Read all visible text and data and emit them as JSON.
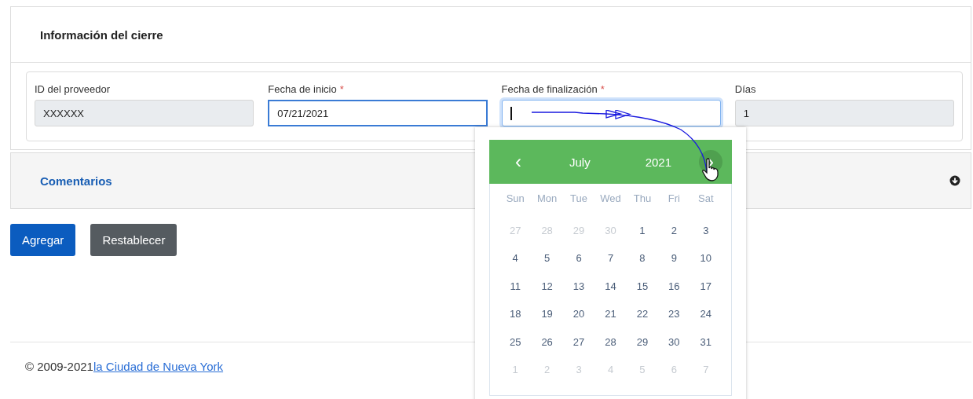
{
  "closure_panel": {
    "title": "Información del cierre",
    "fields": [
      {
        "label": "ID del proveedor",
        "value": "XXXXXX",
        "kind": "readonly"
      },
      {
        "label": "Fecha de inicio",
        "required_mark": "*",
        "value": "07/21/2021",
        "kind": "outlined"
      },
      {
        "label": "Fecha de finalización",
        "required_mark": "*",
        "kind": "focused"
      },
      {
        "label": "Días",
        "value": "1",
        "kind": "readonly"
      }
    ]
  },
  "comments_panel": {
    "title": "Comentarios",
    "expanded": false
  },
  "buttons": [
    {
      "label": "Agregar",
      "kind": "primary"
    },
    {
      "label": "Restablecer",
      "kind": "secondary"
    }
  ],
  "footer": {
    "copyright": "© 2009-2021",
    "link": "la Ciudad de Nueva York"
  },
  "datepicker": {
    "prev": "‹",
    "month": "July",
    "year": "2021",
    "next": "›",
    "next_hovered": true,
    "weekdays": [
      "Sun",
      "Mon",
      "Tue",
      "Wed",
      "Thu",
      "Fri",
      "Sat"
    ],
    "weeks": [
      [
        {
          "day": "27",
          "kind": "other"
        },
        {
          "day": "28",
          "kind": "other"
        },
        {
          "day": "29",
          "kind": "other"
        },
        {
          "day": "30",
          "kind": "other"
        },
        {
          "day": "1",
          "kind": "current"
        },
        {
          "day": "2",
          "kind": "current"
        },
        {
          "day": "3",
          "kind": "current"
        }
      ],
      [
        {
          "day": "4",
          "kind": "current"
        },
        {
          "day": "5",
          "kind": "current"
        },
        {
          "day": "6",
          "kind": "current"
        },
        {
          "day": "7",
          "kind": "current"
        },
        {
          "day": "8",
          "kind": "current"
        },
        {
          "day": "9",
          "kind": "current"
        },
        {
          "day": "10",
          "kind": "current"
        }
      ],
      [
        {
          "day": "11",
          "kind": "current"
        },
        {
          "day": "12",
          "kind": "current"
        },
        {
          "day": "13",
          "kind": "current"
        },
        {
          "day": "14",
          "kind": "current"
        },
        {
          "day": "15",
          "kind": "current"
        },
        {
          "day": "16",
          "kind": "current"
        },
        {
          "day": "17",
          "kind": "current"
        }
      ],
      [
        {
          "day": "18",
          "kind": "current"
        },
        {
          "day": "19",
          "kind": "current"
        },
        {
          "day": "20",
          "kind": "current"
        },
        {
          "day": "21",
          "kind": "current"
        },
        {
          "day": "22",
          "kind": "current"
        },
        {
          "day": "23",
          "kind": "current"
        },
        {
          "day": "24",
          "kind": "current"
        }
      ],
      [
        {
          "day": "25",
          "kind": "current"
        },
        {
          "day": "26",
          "kind": "current"
        },
        {
          "day": "27",
          "kind": "current"
        },
        {
          "day": "28",
          "kind": "current"
        },
        {
          "day": "29",
          "kind": "current"
        },
        {
          "day": "30",
          "kind": "current"
        },
        {
          "day": "31",
          "kind": "current"
        }
      ],
      [
        {
          "day": "1",
          "kind": "other"
        },
        {
          "day": "2",
          "kind": "other"
        },
        {
          "day": "3",
          "kind": "other"
        },
        {
          "day": "4",
          "kind": "other"
        },
        {
          "day": "5",
          "kind": "other"
        },
        {
          "day": "6",
          "kind": "other"
        },
        {
          "day": "7",
          "kind": "other"
        }
      ]
    ]
  }
}
